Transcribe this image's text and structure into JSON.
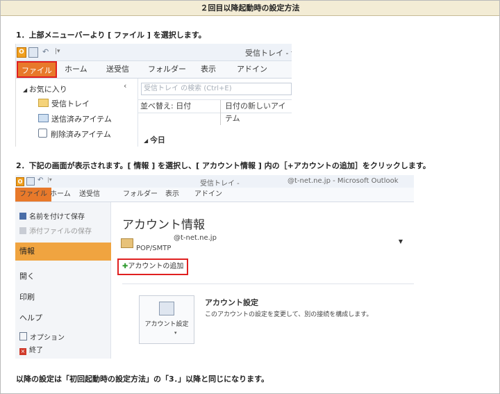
{
  "header": {
    "title": "２回目以降起動時の設定方法"
  },
  "step1": {
    "text": "1．上部メニューバーより [ ファイル ] を選択します。",
    "screenshot": {
      "window_title": "受信トレイ - t",
      "tabs": [
        "ファイル",
        "ホーム",
        "送受信",
        "フォルダー",
        "表示",
        "アドイン"
      ],
      "nav_header": "お気に入り",
      "folders": [
        "受信トレイ",
        "送信済みアイテム",
        "削除済みアイテム"
      ],
      "search_placeholder": "受信トレイ の検索 (Ctrl+E)",
      "sort_label": "並べ替え: 日付",
      "sort_order": "日付の新しいアイテム",
      "group_label": "今日"
    }
  },
  "step2": {
    "text": "2．下記の画面が表示されます。[ 情報 ] を選択し、[ アカウント情報 ] 内の［+アカウントの追加］をクリックします。",
    "screenshot": {
      "window_title": "受信トレイ -",
      "window_title_right": "@t-net.ne.jp - Microsoft Outlook",
      "tabs": [
        "ファイル",
        "ホーム",
        "送受信",
        "フォルダー",
        "表示",
        "アドイン"
      ],
      "left_items": {
        "save_as": "名前を付けて保存",
        "save_attachments": "添付ファイルの保存",
        "info": "情報",
        "open": "開く",
        "print": "印刷",
        "help": "ヘルプ",
        "options": "オプション",
        "exit": "終了"
      },
      "account_info_title": "アカウント情報",
      "account_email": "@t-net.ne.jp",
      "account_type": "POP/SMTP",
      "add_account_label": "アカウントの追加",
      "account_settings_button": "アカウント設定",
      "account_settings_title": "アカウント設定",
      "account_settings_desc": "このアカウントの設定を変更して、別の接続を構成します。"
    }
  },
  "footer": {
    "text": "以降の設定は「初回起動時の設定方法」の「3．」以降と同じになります。"
  },
  "colors": {
    "header_bg": "#f3ecd5",
    "file_tab": "#e8792a",
    "highlight": "#e02020",
    "selected_item": "#f0a440"
  }
}
